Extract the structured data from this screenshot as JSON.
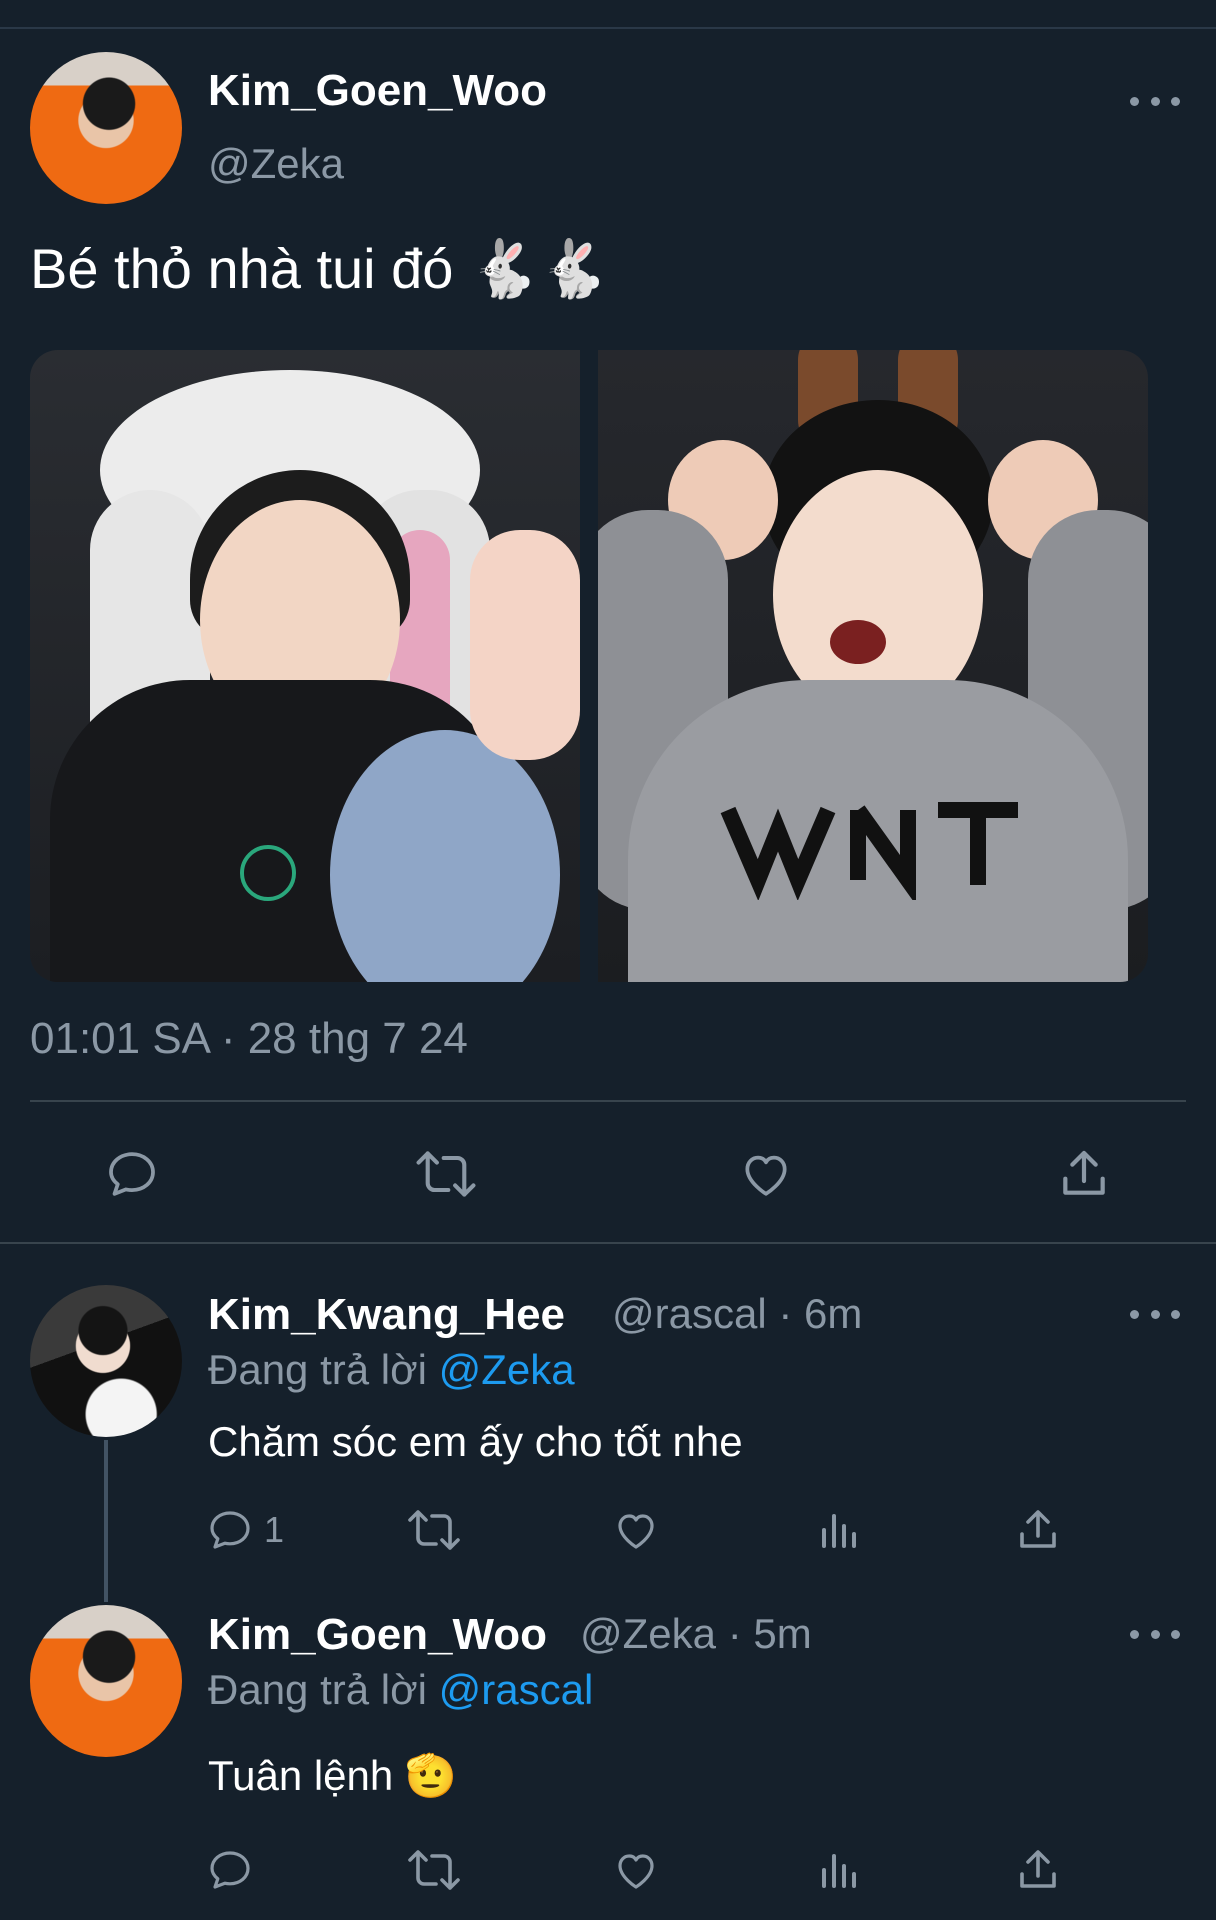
{
  "main_tweet": {
    "author_name": "Kim_Goen_Woo",
    "author_handle": "@Zeka",
    "text": "Bé thỏ nhà tui đó 🐇🐇",
    "timestamp": "01:01 SA · 28 thg 7 24",
    "photos": [
      {
        "icon": "photo-bunny-hat"
      },
      {
        "icon": "photo-bunny-ears"
      }
    ]
  },
  "replies": [
    {
      "author_name": "Kim_Kwang_Hee",
      "author_handle": "@rascal",
      "time": "· 6m",
      "replying_label": "Đang trả lời",
      "replying_to": "@Zeka",
      "text": "Chăm sóc em ấy cho tốt nhe",
      "reply_count": "1"
    },
    {
      "author_name": "Kim_Goen_Woo",
      "author_handle": "@Zeka",
      "time": "· 5m",
      "replying_label": "Đang trả lời",
      "replying_to": "@rascal",
      "text": "Tuân lệnh 🫡",
      "reply_count": ""
    }
  ],
  "colors": {
    "background": "#15202b",
    "secondary_text": "#8b98a5",
    "link": "#1d9bf0",
    "divider": "#38444d"
  }
}
